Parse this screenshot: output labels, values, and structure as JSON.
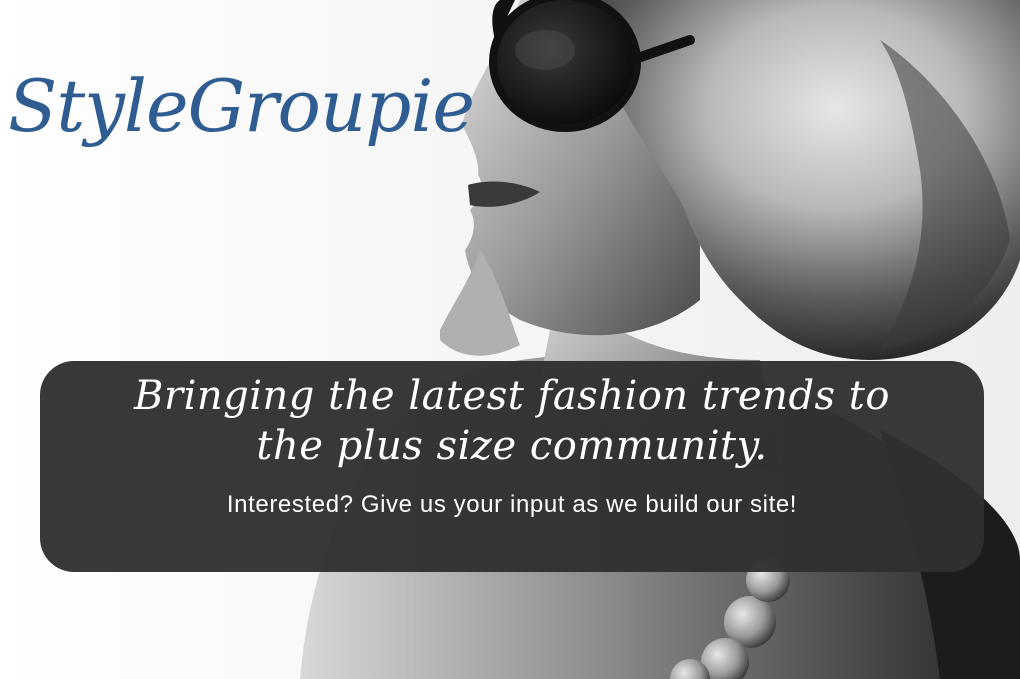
{
  "logo": {
    "text": "StyleGroupie",
    "color": "#2f5d92"
  },
  "banner": {
    "tagline": "Bringing the latest fashion trends to the plus size community.",
    "cta": "Interested? Give us your input as we build our site!",
    "background_color": "#303030"
  },
  "hero_image": {
    "description_icon": "woman-sunglasses-photo"
  }
}
